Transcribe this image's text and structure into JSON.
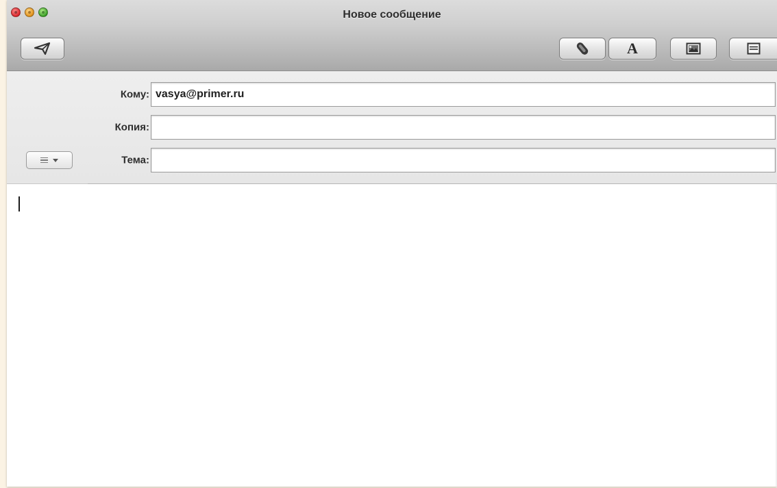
{
  "window": {
    "title": "Новое сообщение"
  },
  "toolbar": {
    "send_icon": "paper-plane-icon",
    "attach_icon": "paperclip-icon",
    "fonts_label": "A",
    "fonts_icon": "fonts-icon",
    "photo_icon": "photo-browser-icon",
    "format_icon": "format-bar-icon"
  },
  "fields": {
    "to_label": "Кому:",
    "to_value": "vasya@primer.ru",
    "cc_label": "Копия:",
    "cc_value": "",
    "subject_label": "Тема:",
    "subject_value": ""
  },
  "account_menu": {
    "icon": "lines-icon",
    "arrow_icon": "triangle-down-icon"
  },
  "body": {
    "text": ""
  },
  "colors": {
    "close": "#d8262b",
    "minimize": "#e0901a",
    "zoom": "#3a9e27",
    "toolbar_top": "#dcdcdc",
    "toolbar_bottom": "#a9a9a9",
    "header_bg": "#eeeeee",
    "page_bg": "#fbf3e4"
  }
}
